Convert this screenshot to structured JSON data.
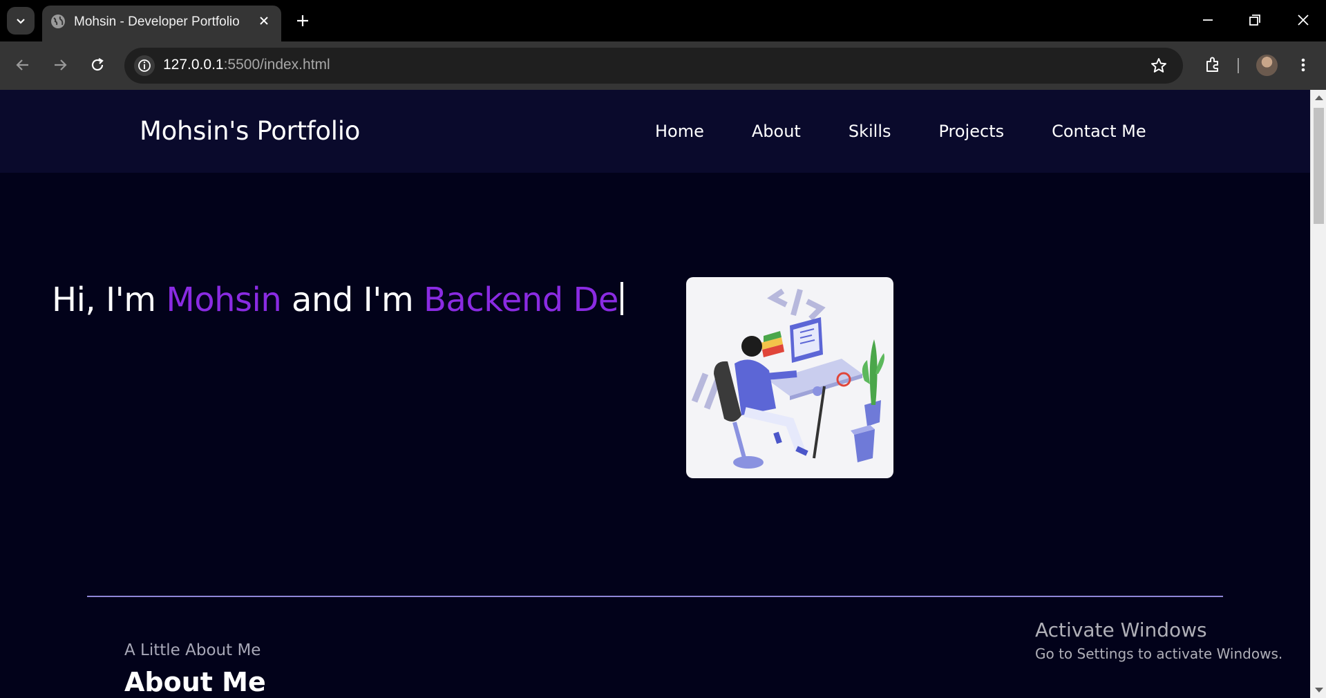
{
  "browser": {
    "tab_title": "Mohsin - Developer Portfolio",
    "url_host": "127.0.0.1",
    "url_path": ":5500/index.html",
    "icons": [
      "tab-search-icon",
      "globe-icon",
      "close-icon",
      "plus-icon",
      "minimize-icon",
      "restore-icon",
      "window-close-icon",
      "back-icon",
      "forward-icon",
      "reload-icon",
      "info-icon",
      "star-icon",
      "extensions-icon",
      "avatar",
      "more-icon"
    ]
  },
  "site": {
    "logo": "Mohsin's Portfolio",
    "nav": [
      "Home",
      "About",
      "Skills",
      "Projects",
      "Contact Me"
    ],
    "hero": {
      "prefix": "Hi, I'm ",
      "name": "Mohsin",
      "middle": " and I'm ",
      "role_typed": "Backend De"
    },
    "about": {
      "subtitle": "A Little About Me",
      "title": "About Me"
    },
    "colors": {
      "background": "#02021a",
      "nav_background": "#0a0a2c",
      "accent": "#8a2be2",
      "divider": "#8f86d8"
    }
  },
  "os_watermark": {
    "line1": "Activate Windows",
    "line2": "Go to Settings to activate Windows."
  }
}
